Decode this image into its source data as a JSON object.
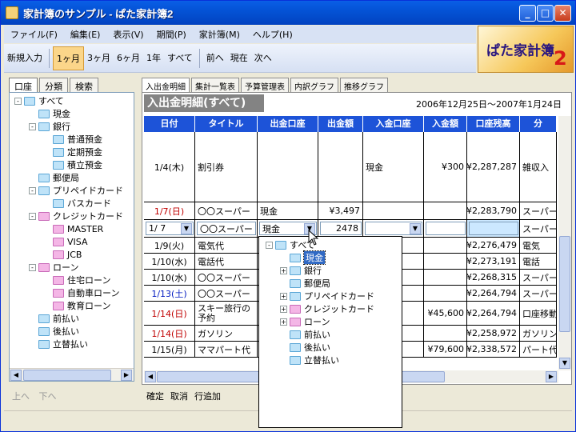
{
  "window": {
    "title": "家計簿のサンプル - ぱた家計簿2"
  },
  "menu": [
    "ファイル(F)",
    "編集(E)",
    "表示(V)",
    "期間(P)",
    "家計簿(M)",
    "ヘルプ(H)"
  ],
  "toolbar": [
    "新規入力",
    "1ヶ月",
    "3ヶ月",
    "6ヶ月",
    "1年",
    "すべて",
    "前へ",
    "現在",
    "次へ"
  ],
  "logo": {
    "text": "ぱた家計簿",
    "num": "2"
  },
  "left_tabs": [
    "口座",
    "分類",
    "検索"
  ],
  "tree": [
    {
      "label": "すべて",
      "level": 0,
      "exp": "-",
      "color": "blue"
    },
    {
      "label": "現金",
      "level": 1,
      "exp": "",
      "color": "blue"
    },
    {
      "label": "銀行",
      "level": 1,
      "exp": "-",
      "color": "blue"
    },
    {
      "label": "普通預金",
      "level": 2,
      "exp": "",
      "color": "blue"
    },
    {
      "label": "定期預金",
      "level": 2,
      "exp": "",
      "color": "blue"
    },
    {
      "label": "積立預金",
      "level": 2,
      "exp": "",
      "color": "blue"
    },
    {
      "label": "郵便局",
      "level": 1,
      "exp": "",
      "color": "blue"
    },
    {
      "label": "プリペイドカード",
      "level": 1,
      "exp": "-",
      "color": "blue"
    },
    {
      "label": "バスカード",
      "level": 2,
      "exp": "",
      "color": "blue"
    },
    {
      "label": "クレジットカード",
      "level": 1,
      "exp": "-",
      "color": "pink"
    },
    {
      "label": "MASTER",
      "level": 2,
      "exp": "",
      "color": "pink"
    },
    {
      "label": "VISA",
      "level": 2,
      "exp": "",
      "color": "pink"
    },
    {
      "label": "JCB",
      "level": 2,
      "exp": "",
      "color": "pink"
    },
    {
      "label": "ローン",
      "level": 1,
      "exp": "-",
      "color": "pink"
    },
    {
      "label": "住宅ローン",
      "level": 2,
      "exp": "",
      "color": "pink"
    },
    {
      "label": "自動車ローン",
      "level": 2,
      "exp": "",
      "color": "pink"
    },
    {
      "label": "教育ローン",
      "level": 2,
      "exp": "",
      "color": "pink"
    },
    {
      "label": "前払い",
      "level": 1,
      "exp": "",
      "color": "blue"
    },
    {
      "label": "後払い",
      "level": 1,
      "exp": "",
      "color": "blue"
    },
    {
      "label": "立替払い",
      "level": 1,
      "exp": "",
      "color": "blue"
    }
  ],
  "left_nav": {
    "up": "上へ",
    "down": "下へ"
  },
  "right_tabs": [
    "入出金明細",
    "集計一覧表",
    "予算管理表",
    "内訳グラフ",
    "推移グラフ"
  ],
  "panel": {
    "title": "入出金明細(すべて)",
    "period": "2006年12月25日～2007年1月24日"
  },
  "columns": [
    "日付",
    "タイトル",
    "出金口座",
    "出金額",
    "入金口座",
    "入金額",
    "口座残高",
    "分"
  ],
  "rows": [
    {
      "date": "1/4(木)",
      "title": "割引券",
      "out_acct": "",
      "out_amt": "",
      "in_acct": "現金",
      "in_amt": "¥300",
      "bal": "¥2,287,287",
      "cat": "雑収入",
      "color": "black"
    },
    {
      "date": "1/7(日)",
      "title": "〇〇スーパー",
      "out_acct": "現金",
      "out_amt": "¥3,497",
      "in_acct": "",
      "in_amt": "",
      "bal": "¥2,283,790",
      "cat": "スーパー",
      "color": "red"
    },
    {
      "date": "1/ 7",
      "title": "〇〇スーパー",
      "out_acct": "現金",
      "out_amt": "2478",
      "in_acct": "",
      "in_amt": "",
      "bal": "",
      "cat": "スーパー",
      "color": "black"
    },
    {
      "date": "1/9(火)",
      "title": "電気代",
      "out_acct": "",
      "out_amt": "",
      "in_acct": "",
      "in_amt": "",
      "bal": "¥2,276,479",
      "cat": "電気",
      "color": "black"
    },
    {
      "date": "1/10(水)",
      "title": "電話代",
      "out_acct": "",
      "out_amt": "",
      "in_acct": "",
      "in_amt": "",
      "bal": "¥2,273,191",
      "cat": "電話",
      "color": "black"
    },
    {
      "date": "1/10(水)",
      "title": "〇〇スーパー",
      "out_acct": "",
      "out_amt": "",
      "in_acct": "",
      "in_amt": "",
      "bal": "¥2,268,315",
      "cat": "スーパー",
      "color": "black"
    },
    {
      "date": "1/13(土)",
      "title": "〇〇スーパー",
      "out_acct": "",
      "out_amt": "",
      "in_acct": "",
      "in_amt": "",
      "bal": "¥2,264,794",
      "cat": "スーパー",
      "color": "blue"
    },
    {
      "date": "1/14(日)",
      "title": "スキー旅行の予約",
      "out_acct": "",
      "out_amt": "",
      "in_acct": "",
      "in_amt": "¥45,600",
      "bal": "¥2,264,794",
      "cat": "口座移動",
      "color": "red"
    },
    {
      "date": "1/14(日)",
      "title": "ガソリン",
      "out_acct": "",
      "out_amt": "",
      "in_acct": "",
      "in_amt": "",
      "bal": "¥2,258,972",
      "cat": "ガソリン",
      "color": "red"
    },
    {
      "date": "1/15(月)",
      "title": "ママパート代",
      "out_acct": "",
      "out_amt": "",
      "in_acct": "",
      "in_amt": "¥79,600",
      "bal": "¥2,338,572",
      "cat": "パート代",
      "color": "black"
    }
  ],
  "popup_tree": [
    {
      "label": "すべて",
      "level": 0,
      "exp": "-",
      "color": "blue"
    },
    {
      "label": "現金",
      "level": 1,
      "exp": "",
      "color": "blue",
      "sel": true
    },
    {
      "label": "銀行",
      "level": 1,
      "exp": "+",
      "color": "blue"
    },
    {
      "label": "郵便局",
      "level": 1,
      "exp": "",
      "color": "blue"
    },
    {
      "label": "プリペイドカード",
      "level": 1,
      "exp": "+",
      "color": "blue"
    },
    {
      "label": "クレジットカード",
      "level": 1,
      "exp": "+",
      "color": "pink"
    },
    {
      "label": "ローン",
      "level": 1,
      "exp": "+",
      "color": "pink"
    },
    {
      "label": "前払い",
      "level": 1,
      "exp": "",
      "color": "blue"
    },
    {
      "label": "後払い",
      "level": 1,
      "exp": "",
      "color": "blue"
    },
    {
      "label": "立替払い",
      "level": 1,
      "exp": "",
      "color": "blue"
    }
  ],
  "bottom": [
    "確定",
    "取消",
    "行追加"
  ]
}
